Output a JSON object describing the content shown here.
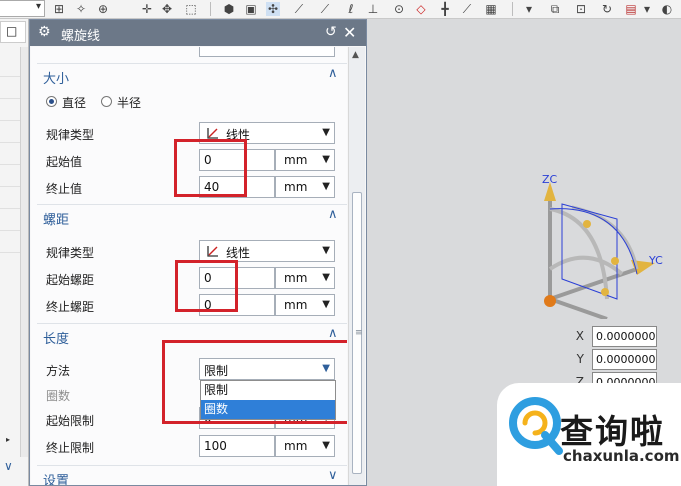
{
  "dialog": {
    "title": "螺旋线"
  },
  "sections": {
    "size": {
      "title": "大小",
      "radio_diameter": "直径",
      "radio_radius": "半径",
      "law_type_label": "规律类型",
      "law_type_value": "线性",
      "start_label": "起始值",
      "start_value": "0",
      "start_unit": "mm",
      "end_label": "终止值",
      "end_value": "40",
      "end_unit": "mm"
    },
    "pitch": {
      "title": "螺距",
      "law_type_label": "规律类型",
      "law_type_value": "线性",
      "start_label": "起始螺距",
      "start_value": "0",
      "start_unit": "mm",
      "end_label": "终止螺距",
      "end_value": "0",
      "end_unit": "mm"
    },
    "length": {
      "title": "长度",
      "method_label": "方法",
      "method_value": "限制",
      "turns_label": "圈数",
      "start_limit_label": "起始限制",
      "start_limit_value": "0",
      "start_limit_unit": "mm",
      "end_limit_label": "终止限制",
      "end_limit_value": "100",
      "end_limit_unit": "mm",
      "dropdown_options": [
        "限制",
        "圈数"
      ],
      "dropdown_selected": "圈数"
    },
    "settings": {
      "title": "设置"
    }
  },
  "viewport": {
    "axis_z": "ZC",
    "axis_y": "YC",
    "coords": {
      "x_label": "X",
      "x_value": "0.0000000",
      "y_label": "Y",
      "y_value": "0.0000000",
      "z_label": "Z",
      "z_value": "0.0000000"
    }
  },
  "watermark": {
    "text": "查询啦",
    "url": "chaxunla.com"
  },
  "colors": {
    "accent_title": "#2f5f9a",
    "highlight_red": "#d3222a",
    "selection_blue": "#2f7fd8",
    "titlebar": "#6c7888"
  }
}
